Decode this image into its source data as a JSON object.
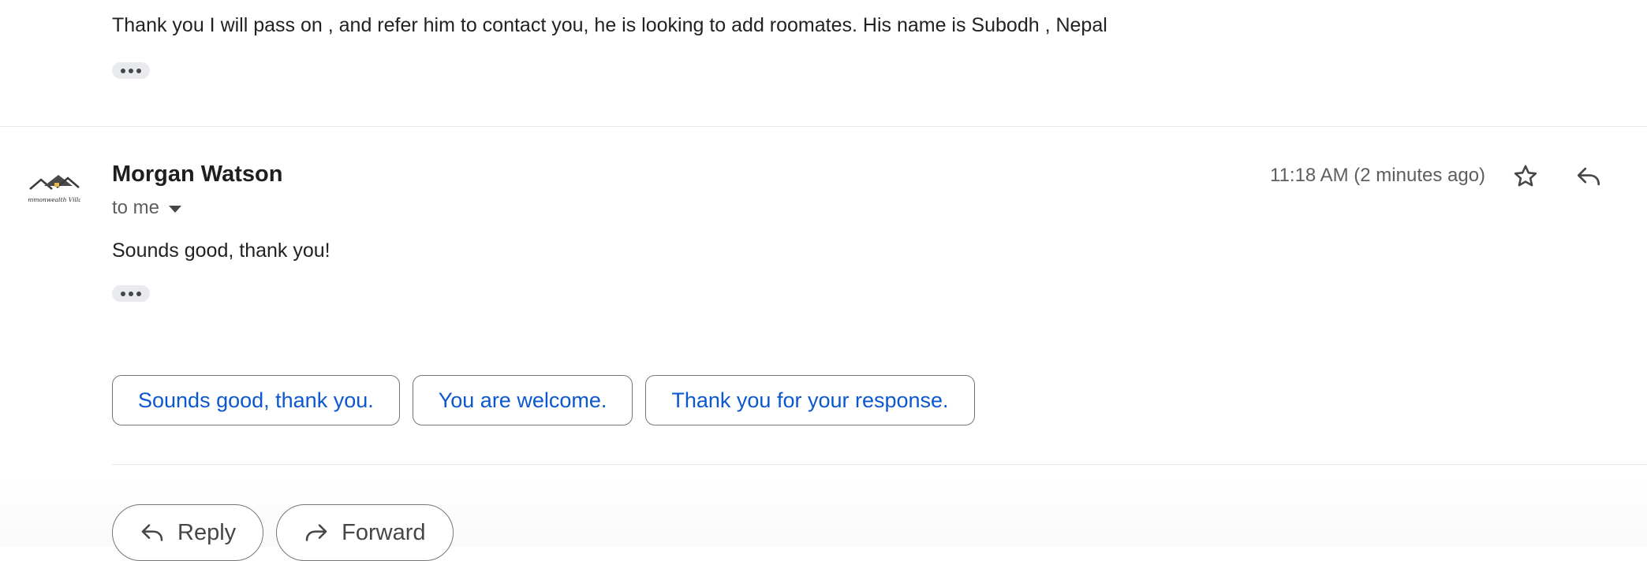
{
  "previous_message": {
    "body": "Thank you I will pass on , and refer him to contact you, he is looking to add roomates. His name is Subodh , Nepal"
  },
  "message": {
    "sender": "Morgan Watson",
    "recipient": "to me",
    "timestamp": "11:18 AM (2 minutes ago)",
    "body": "Sounds good, thank you!",
    "avatar_logo_text": "Commonwealth Village"
  },
  "smart_replies": [
    {
      "label": "Sounds good, thank you."
    },
    {
      "label": "You are welcome."
    },
    {
      "label": "Thank you for your response."
    }
  ],
  "actions": {
    "reply_label": "Reply",
    "forward_label": "Forward"
  },
  "icons": {
    "star": "star-icon",
    "reply": "reply-icon",
    "forward": "forward-icon",
    "more": "more-horiz-icon",
    "expand": "caret-down-icon"
  },
  "colors": {
    "chip_text": "#0b57d0",
    "chip_border": "#747775",
    "secondary_text": "#5e5e5e",
    "divider": "#e6e6e6"
  }
}
